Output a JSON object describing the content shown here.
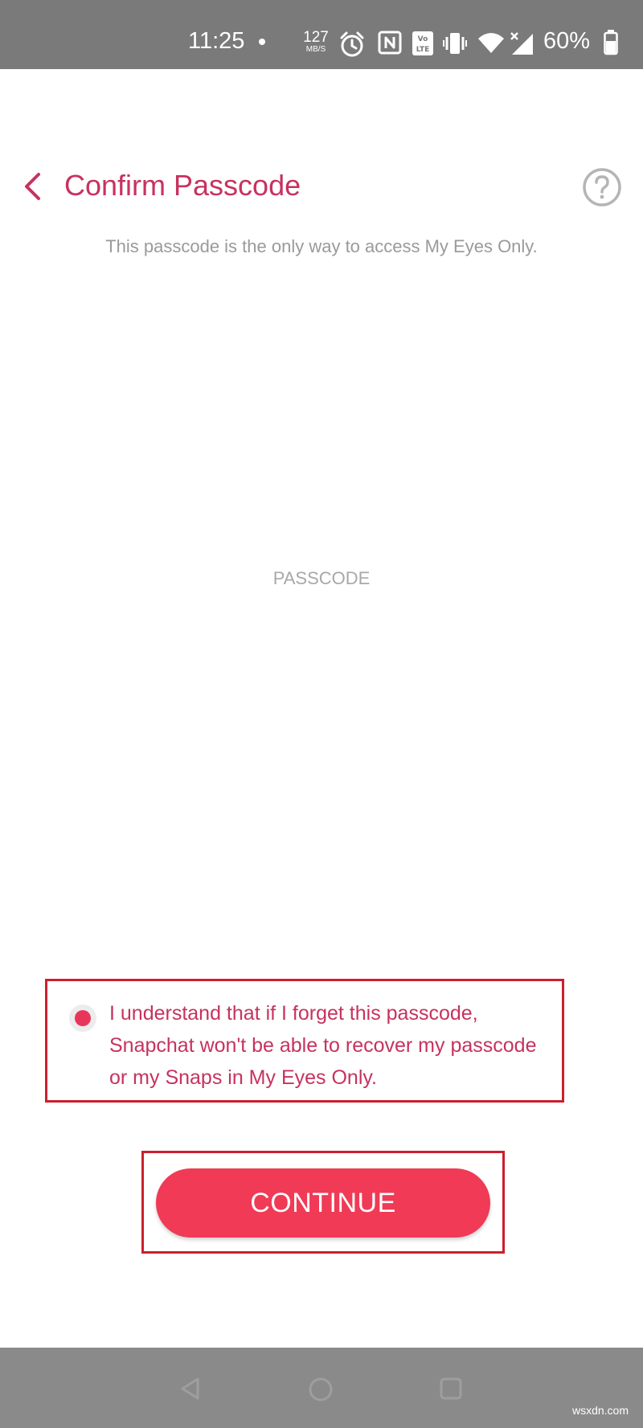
{
  "status_bar": {
    "time": "11:25",
    "net_speed": "127",
    "net_speed_unit": "MB/S",
    "battery": "60%",
    "icons": [
      "alarm-icon",
      "nfc-icon",
      "volte-icon",
      "vibrate-icon",
      "wifi-icon",
      "signal-icon",
      "battery-icon"
    ]
  },
  "header": {
    "title": "Confirm Passcode",
    "subtitle": "This passcode is the only way to access My Eyes Only."
  },
  "passcode": {
    "placeholder": "PASSCODE"
  },
  "agreement": {
    "checked": true,
    "text": "I understand that if I forget this passcode, Snapchat won't be able to recover my passcode or my Snaps in My Eyes Only."
  },
  "continue": {
    "label": "CONTINUE"
  },
  "nav_bar": {
    "icons": [
      "back-triangle-icon",
      "home-circle-icon",
      "recents-square-icon"
    ]
  },
  "watermark": "wsxdn.com",
  "colors": {
    "brand_text": "#c7325f",
    "button": "#f03a56",
    "highlight_border": "#cc1f2e",
    "status_bar": "#7a7a7a",
    "nav_bar": "#8a8a8a"
  }
}
